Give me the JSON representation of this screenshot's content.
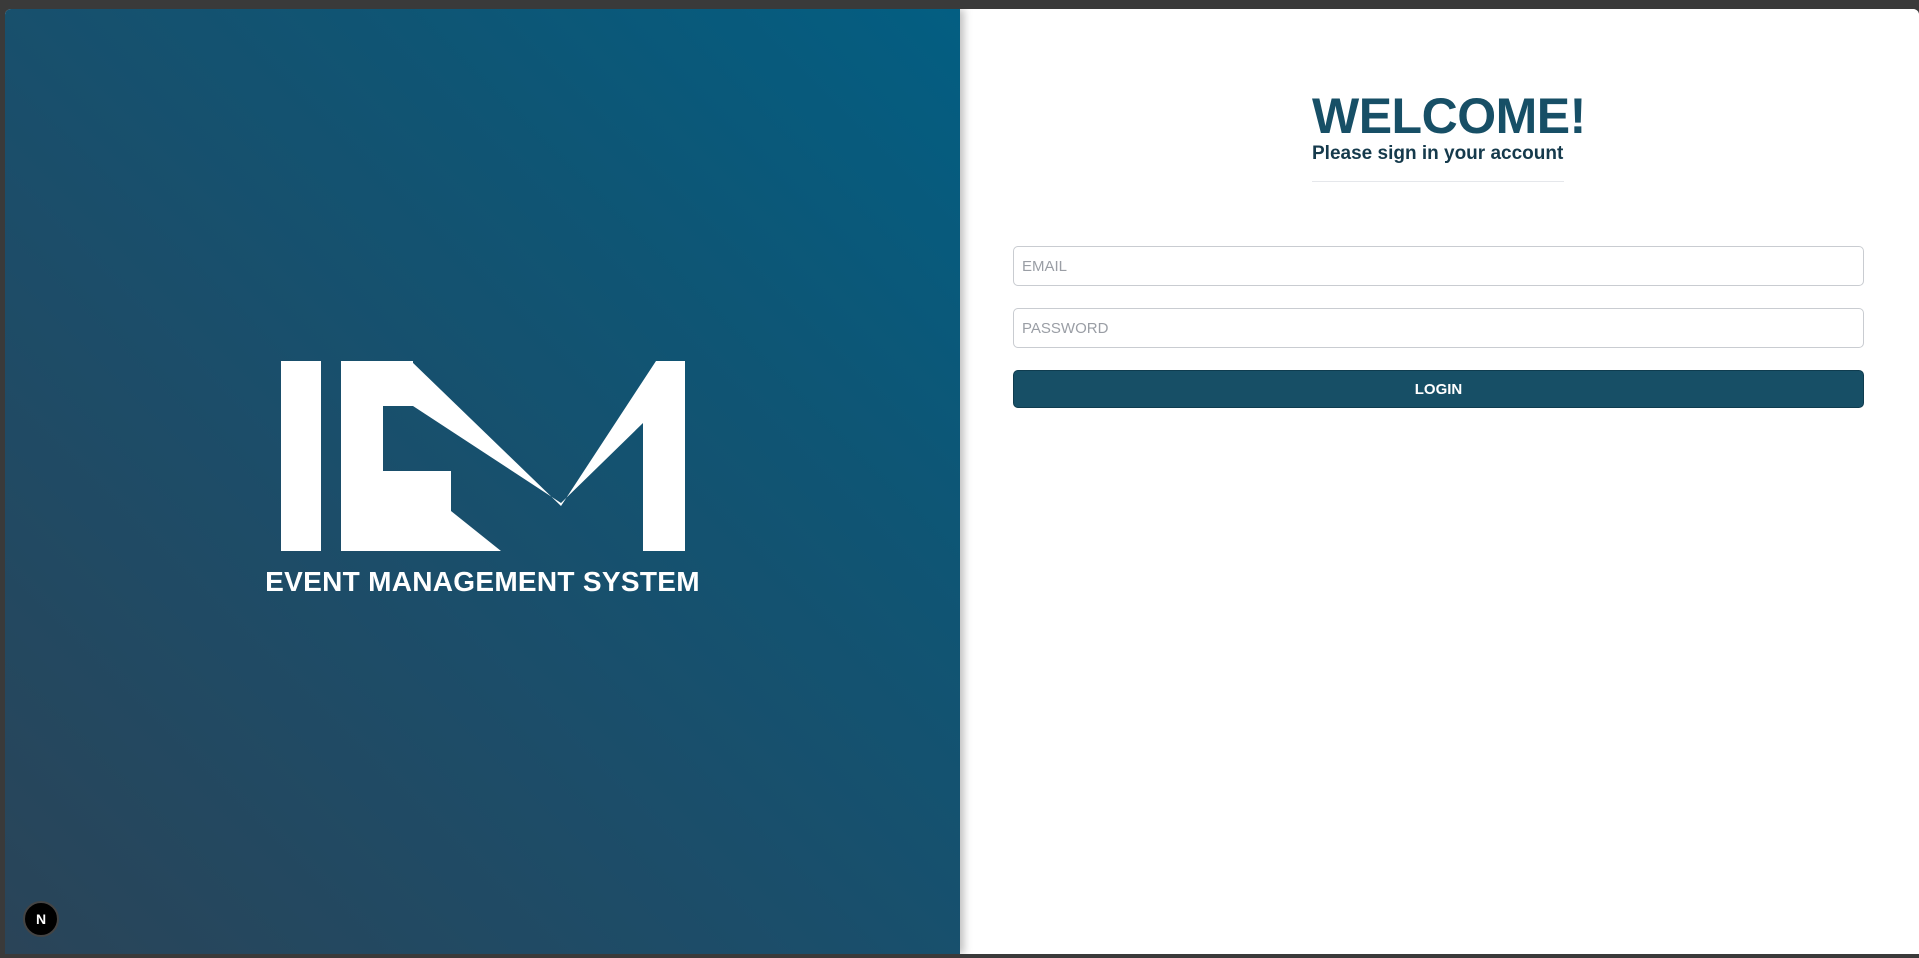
{
  "brand": {
    "logo_text": "IEM",
    "name": "EVENT MANAGEMENT SYSTEM"
  },
  "dev_badge": {
    "label": "N"
  },
  "login": {
    "title": "WELCOME!",
    "subtitle": "Please sign in your account",
    "email_placeholder": "EMAIL",
    "password_placeholder": "PASSWORD",
    "button_label": "LOGIN"
  },
  "colors": {
    "primary": "#174f66",
    "gradient_start": "#035e82",
    "gradient_end": "#2a4458"
  }
}
